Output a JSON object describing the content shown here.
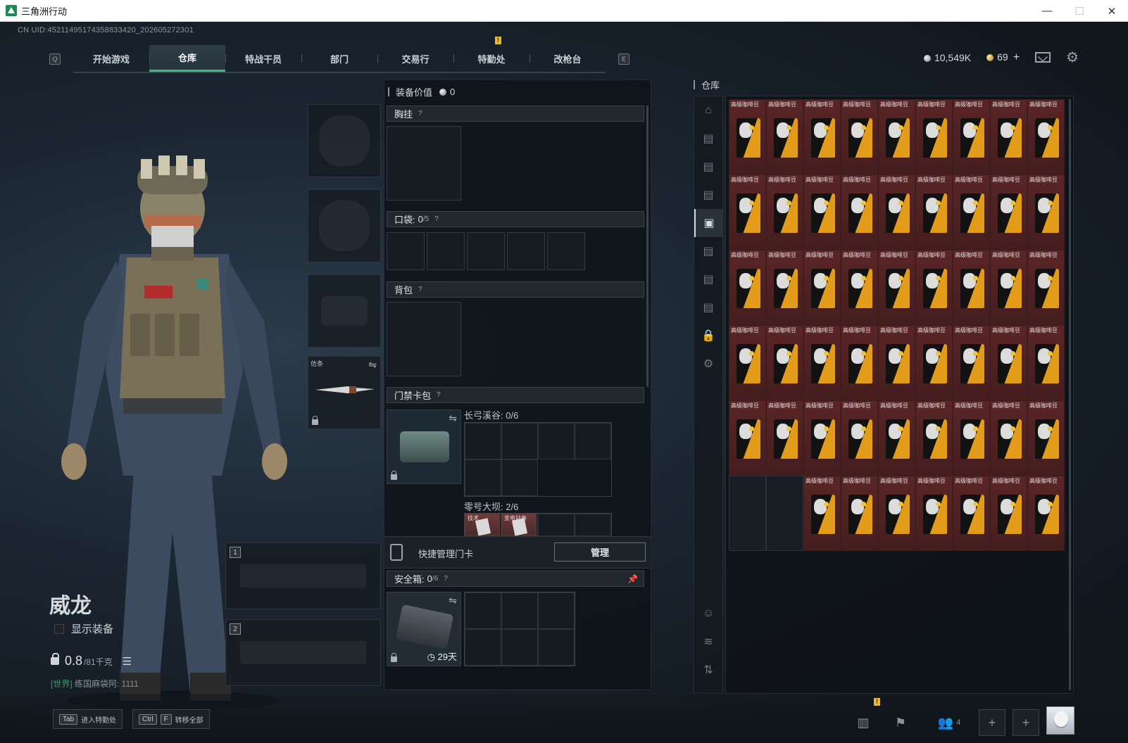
{
  "window": {
    "title": "三角洲行动",
    "minimize": "—",
    "maximize": "☐",
    "close": "✕"
  },
  "uid": "CN UID:45211495174358833420_202605272301",
  "nav": {
    "key_left": "Q",
    "key_right": "E",
    "tabs": [
      {
        "label": "开始游戏"
      },
      {
        "label": "仓库",
        "active": true
      },
      {
        "label": "特战干员"
      },
      {
        "label": "部门"
      },
      {
        "label": "交易行"
      },
      {
        "label": "特勤处",
        "alert": "!"
      },
      {
        "label": "改枪台"
      }
    ]
  },
  "currency": {
    "silver": "10,549K",
    "gold": "69",
    "plus": "+"
  },
  "character": {
    "name": "威龙",
    "show_equip_label": "显示装备",
    "weight": "0.8",
    "weight_max": "/81千克",
    "chat_channel": "[世界]",
    "chat_text": "练国麻袋阿: 1111"
  },
  "loadout": {
    "melee_label": "信条",
    "weapon_slot_1": "1",
    "weapon_slot_2": "2"
  },
  "equipment": {
    "value_label": "装备价值",
    "value": "0",
    "chest_rig_label": "胸挂",
    "pockets_label": "口袋:",
    "pockets_value": "0",
    "pockets_max": "/5",
    "backpack_label": "背包",
    "keycard_label": "门禁卡包",
    "keycard_map1": "长弓溪谷: 0/6",
    "keycard_map2": "零号大坝: 2/6",
    "mini_items": [
      "技术",
      "变电站备"
    ],
    "quick_manage_label": "快捷管理门卡",
    "manage_btn": "管理",
    "safebox_label": "安全箱:",
    "safebox_value": "0",
    "safebox_max": "/6",
    "safebox_timer": "29天",
    "help": "?"
  },
  "warehouse": {
    "title": "仓库",
    "item_name": "高级咖啡豆",
    "cols": 9,
    "rows": 6,
    "empty_cells": [
      45,
      46
    ],
    "item_colors": {
      "bag": "#e39b1a",
      "cell_bg": "#5a2526"
    }
  },
  "bottom": {
    "hint1_key": "Tab",
    "hint1_label": "进入特勤处",
    "hint2_key1": "Ctrl",
    "hint2_key2": "F",
    "hint2_label": "转移全部",
    "friends_count": "4",
    "alert": "!"
  }
}
